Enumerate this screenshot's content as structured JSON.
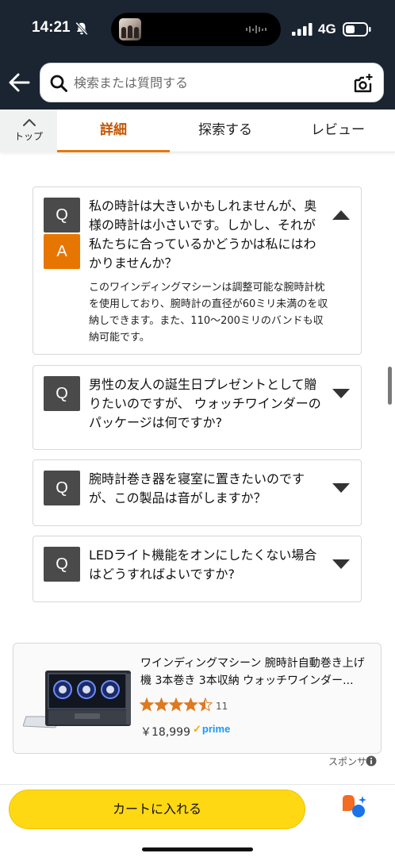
{
  "status_bar": {
    "time": "14:21",
    "network": "4G",
    "icons": [
      "bell-slash-icon",
      "signal-bars-icon",
      "battery-icon"
    ]
  },
  "header": {
    "search_placeholder": "検索または質問する",
    "icons": [
      "back-arrow-icon",
      "search-icon",
      "camera-icon"
    ]
  },
  "tabs": {
    "top_label": "トップ",
    "items": [
      {
        "label": "詳細",
        "active": true
      },
      {
        "label": "探索する",
        "active": false
      },
      {
        "label": "レビュー",
        "active": false
      }
    ]
  },
  "qa": {
    "q_badge": "Q",
    "a_badge": "A",
    "items": [
      {
        "question": "私の時計は大きいかもしれませんが、奥様の時計は小さいです。しかし、それが私たちに合っているかどうかは私にはわかりませんか？",
        "answer": "このワインディングマシーンは調整可能な腕時計枕を使用しており、腕時計の直径が60ミリ未満のを収納しできます。また、110〜200ミリのバンドも収納可能です。",
        "expanded": true
      },
      {
        "question": "男性の友人の誕生日プレゼントとして贈りたいのですが、 ウォッチワインダーのパッケージは何ですか?",
        "expanded": false
      },
      {
        "question": "腕時計巻き器を寝室に置きたいのですが、この製品は音がしますか？",
        "expanded": false
      },
      {
        "question": "LEDライト機能をオンにしたくない場合はどうすればよいですか?",
        "expanded": false
      }
    ]
  },
  "sponsored": {
    "title": "ワインディングマシーン 腕時計自動巻き上げ機 3本巻き 3本収納 ウォッチワインダー...",
    "rating": 4.5,
    "rating_count": "11",
    "price": "￥18,999",
    "prime": "prime",
    "label": "スポンサー"
  },
  "bottom": {
    "cart_label": "カートに入れる"
  },
  "colors": {
    "header_bg": "#1b2431",
    "accent": "#e47911",
    "active_tab_text": "#c45500",
    "cart_button": "#ffd814",
    "a_badge": "#e77600",
    "q_badge": "#4a4a4a",
    "prime": "#1a98ff",
    "star": "#de7921"
  }
}
